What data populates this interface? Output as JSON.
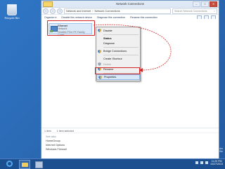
{
  "desktop": {
    "recycle_bin_label": "Recycle Bin",
    "watermark": [
      "Center",
      "0 Site"
    ]
  },
  "window": {
    "title": "Network Connections",
    "controls": {
      "minimize": "–",
      "maximize": "□",
      "close": "✕"
    },
    "address": {
      "root": "Network and Internet",
      "current": "Network Connections"
    },
    "search_placeholder": "Search Network Connections",
    "commands": [
      "Organize ▾",
      "Disable this network device",
      "Diagnose this connection",
      "Rename this connection",
      "View status of this connection"
    ]
  },
  "connection": {
    "name": "Ethernet",
    "status": "Network",
    "device": "Realtek PCIe FE Family Contr..."
  },
  "context_menu": {
    "items": [
      {
        "label": "Disable",
        "style": "",
        "icon": "shield"
      },
      {
        "label": "Status",
        "style": "bold",
        "icon": ""
      },
      {
        "label": "Diagnose",
        "style": "",
        "icon": ""
      },
      {
        "label": "Bridge Connections",
        "style": "",
        "icon": "shield"
      },
      {
        "label": "Create Shortcut",
        "style": "",
        "icon": ""
      },
      {
        "label": "Delete",
        "style": "disabled",
        "icon": "shield"
      },
      {
        "label": "Rename",
        "style": "",
        "icon": "shield"
      },
      {
        "label": "Properties",
        "style": "highlighted",
        "icon": "shield"
      }
    ]
  },
  "status_bar": {
    "count": "1 item",
    "selected": "1 item selected"
  },
  "see_also": {
    "heading": "See also",
    "links": [
      "HomeGroup",
      "Internet Options",
      "Windows Firewall"
    ]
  },
  "taskbar": {
    "time": "11:20 PM",
    "date": "10/27/2013"
  },
  "colors": {
    "annotation": "#d32525",
    "taskbar": "#1c4f8f",
    "selection": "#dce9f8"
  }
}
